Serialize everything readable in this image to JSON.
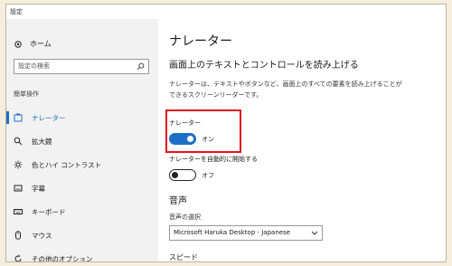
{
  "window": {
    "title": "設定"
  },
  "sidebar": {
    "home_label": "ホーム",
    "search_placeholder": "設定の検索",
    "section_label": "簡単操作",
    "items": [
      {
        "label": "ナレーター",
        "icon": "narrator-icon",
        "active": true
      },
      {
        "label": "拡大鏡",
        "icon": "magnifier-icon",
        "active": false
      },
      {
        "label": "色とハイ コントラスト",
        "icon": "brightness-icon",
        "active": false
      },
      {
        "label": "字幕",
        "icon": "captions-icon",
        "active": false
      },
      {
        "label": "キーボード",
        "icon": "keyboard-icon",
        "active": false
      },
      {
        "label": "マウス",
        "icon": "mouse-icon",
        "active": false
      },
      {
        "label": "その他のオプション",
        "icon": "refresh-icon",
        "active": false
      }
    ]
  },
  "main": {
    "title": "ナレーター",
    "subtitle": "画面上のテキストとコントロールを読み上げる",
    "description": "ナレーターは、テキストやボタンなど、画面上のすべての要素を読み上げることができるスクリーンリーダーです。",
    "narrator_toggle": {
      "label": "ナレーター",
      "state_label": "オン",
      "on": true
    },
    "autostart_toggle": {
      "label": "ナレーターを自動的に開始する",
      "state_label": "オフ",
      "on": false
    },
    "voice_section_title": "音声",
    "voice_select_label": "音声の選択",
    "voice_selected": "Microsoft Haruka Desktop - Japanese",
    "speed_section_title": "スピード"
  },
  "colors": {
    "accent": "#1c6fc4",
    "highlight": "#e0141e"
  }
}
